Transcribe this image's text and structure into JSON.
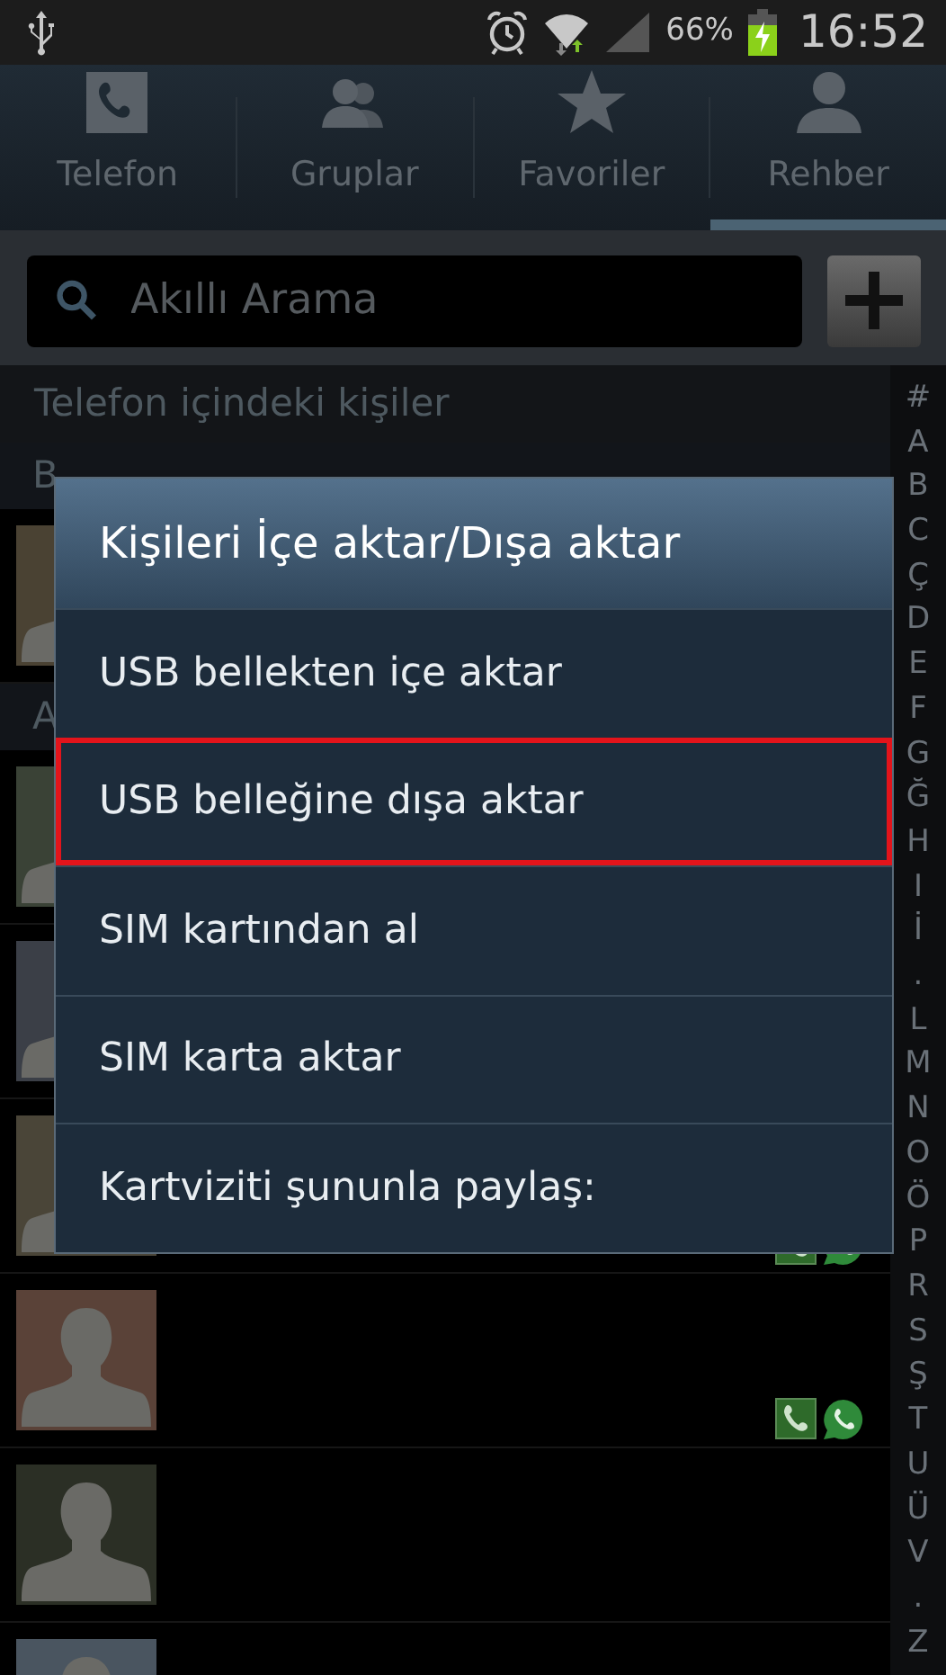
{
  "status_bar": {
    "battery": "66%",
    "time": "16:52"
  },
  "tabs": [
    {
      "label": "Telefon",
      "kind": "phone",
      "selected": false
    },
    {
      "label": "Gruplar",
      "kind": "groups",
      "selected": false
    },
    {
      "label": "Favoriler",
      "kind": "star",
      "selected": false
    },
    {
      "label": "Rehber",
      "kind": "person",
      "selected": true
    }
  ],
  "search": {
    "placeholder": "Akıllı Arama"
  },
  "section_header": "Telefon içindeki kişiler",
  "sections": [
    {
      "letter": "B",
      "contacts": [
        {
          "color": "#4a4233"
        }
      ]
    },
    {
      "letter": "A",
      "contacts": [
        {
          "color": "#3a4236"
        },
        {
          "color": "#3b3f47"
        },
        {
          "color": "#4a4538",
          "shortcuts": true
        },
        {
          "color": "#5a4238",
          "shortcuts": true
        },
        {
          "color": "#2b2f25"
        },
        {
          "color": "#4a5560"
        }
      ]
    }
  ],
  "index": [
    "#",
    "A",
    "B",
    "C",
    "Ç",
    "D",
    "E",
    "F",
    "G",
    "Ğ",
    "H",
    "I",
    "İ",
    ".",
    "L",
    "M",
    "N",
    "O",
    "Ö",
    "P",
    "R",
    "S",
    "Ş",
    "T",
    "U",
    "Ü",
    "V",
    ".",
    "Z"
  ],
  "dialog": {
    "title": "Kişileri İçe aktar/Dışa aktar",
    "items": [
      {
        "label": "USB bellekten içe aktar",
        "highlighted": false
      },
      {
        "label": "USB belleğine dışa aktar",
        "highlighted": true
      },
      {
        "label": "SIM kartından al",
        "highlighted": false
      },
      {
        "label": "SIM karta aktar",
        "highlighted": false
      },
      {
        "label": "Kartviziti şununla paylaş:",
        "highlighted": false
      }
    ]
  }
}
